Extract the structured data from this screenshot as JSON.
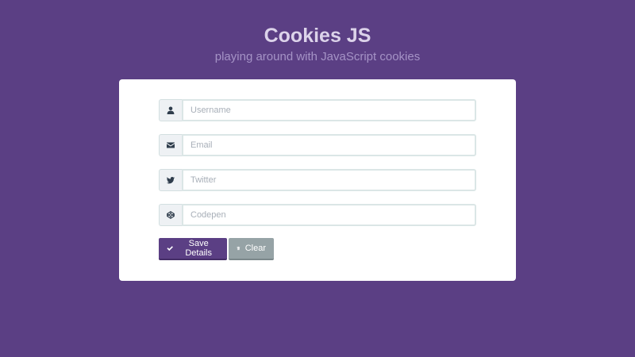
{
  "header": {
    "title": "Cookies JS",
    "subtitle": "playing around with JavaScript cookies"
  },
  "form": {
    "fields": [
      {
        "name": "username",
        "icon": "user-icon",
        "placeholder": "Username",
        "value": ""
      },
      {
        "name": "email",
        "icon": "envelope-icon",
        "placeholder": "Email",
        "value": ""
      },
      {
        "name": "twitter",
        "icon": "twitter-icon",
        "placeholder": "Twitter",
        "value": ""
      },
      {
        "name": "codepen",
        "icon": "codepen-icon",
        "placeholder": "Codepen",
        "value": ""
      }
    ],
    "buttons": {
      "save_label": "Save Details",
      "save_icon": "check-icon",
      "clear_label": "Clear",
      "clear_icon": "trash-icon"
    }
  },
  "colors": {
    "background": "#5b3f84",
    "card": "#ffffff",
    "primary_button": "#5b3f84",
    "secondary_button": "#96a3a6"
  }
}
